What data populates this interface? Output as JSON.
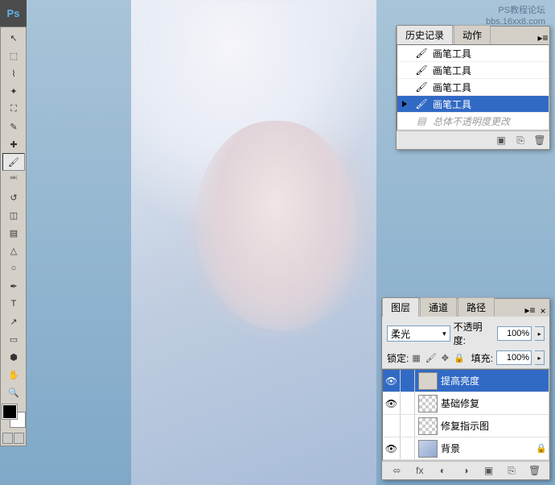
{
  "watermark": {
    "line1": "PS教程论坛",
    "line2": "bbs.16xx8.com"
  },
  "app": {
    "logo": "Ps"
  },
  "toolbox": {
    "tools": [
      {
        "name": "move-tool",
        "glyph": "↖"
      },
      {
        "name": "marquee-tool",
        "glyph": "⬚"
      },
      {
        "name": "lasso-tool",
        "glyph": "⌇"
      },
      {
        "name": "wand-tool",
        "glyph": "✦"
      },
      {
        "name": "crop-tool",
        "glyph": "⛶"
      },
      {
        "name": "eyedropper-tool",
        "glyph": "✎"
      },
      {
        "name": "healing-tool",
        "glyph": "✚"
      },
      {
        "name": "brush-tool",
        "glyph": "🖌",
        "active": true
      },
      {
        "name": "stamp-tool",
        "glyph": "⎃"
      },
      {
        "name": "history-brush-tool",
        "glyph": "↺"
      },
      {
        "name": "eraser-tool",
        "glyph": "◫"
      },
      {
        "name": "gradient-tool",
        "glyph": "▤"
      },
      {
        "name": "blur-tool",
        "glyph": "△"
      },
      {
        "name": "dodge-tool",
        "glyph": "○"
      },
      {
        "name": "pen-tool",
        "glyph": "✒"
      },
      {
        "name": "type-tool",
        "glyph": "T"
      },
      {
        "name": "path-tool",
        "glyph": "↗"
      },
      {
        "name": "shape-tool",
        "glyph": "▭"
      },
      {
        "name": "3d-tool",
        "glyph": "⬢"
      },
      {
        "name": "hand-tool",
        "glyph": "✋"
      },
      {
        "name": "zoom-tool",
        "glyph": "🔍"
      }
    ]
  },
  "history": {
    "tab1": "历史记录",
    "tab2": "动作",
    "items": [
      {
        "label": "画笔工具"
      },
      {
        "label": "画笔工具"
      },
      {
        "label": "画笔工具"
      },
      {
        "label": "画笔工具",
        "selected": true
      },
      {
        "label": "总体不透明度更改",
        "disabled": true,
        "icon": "doc"
      }
    ]
  },
  "layers": {
    "tabs": {
      "layers": "图层",
      "channels": "通道",
      "paths": "路径"
    },
    "blend_mode": "柔光",
    "opacity_label": "不透明度:",
    "opacity_value": "100%",
    "lock_label": "锁定:",
    "fill_label": "填充:",
    "fill_value": "100%",
    "items": [
      {
        "name": "提高亮度",
        "visible": true,
        "selected": true,
        "thumb": "light"
      },
      {
        "name": "基础修复",
        "visible": true,
        "thumb": "checker"
      },
      {
        "name": "修复指示图",
        "visible": false,
        "thumb": "checker"
      },
      {
        "name": "背景",
        "visible": true,
        "locked": true,
        "thumb": "img"
      }
    ]
  }
}
